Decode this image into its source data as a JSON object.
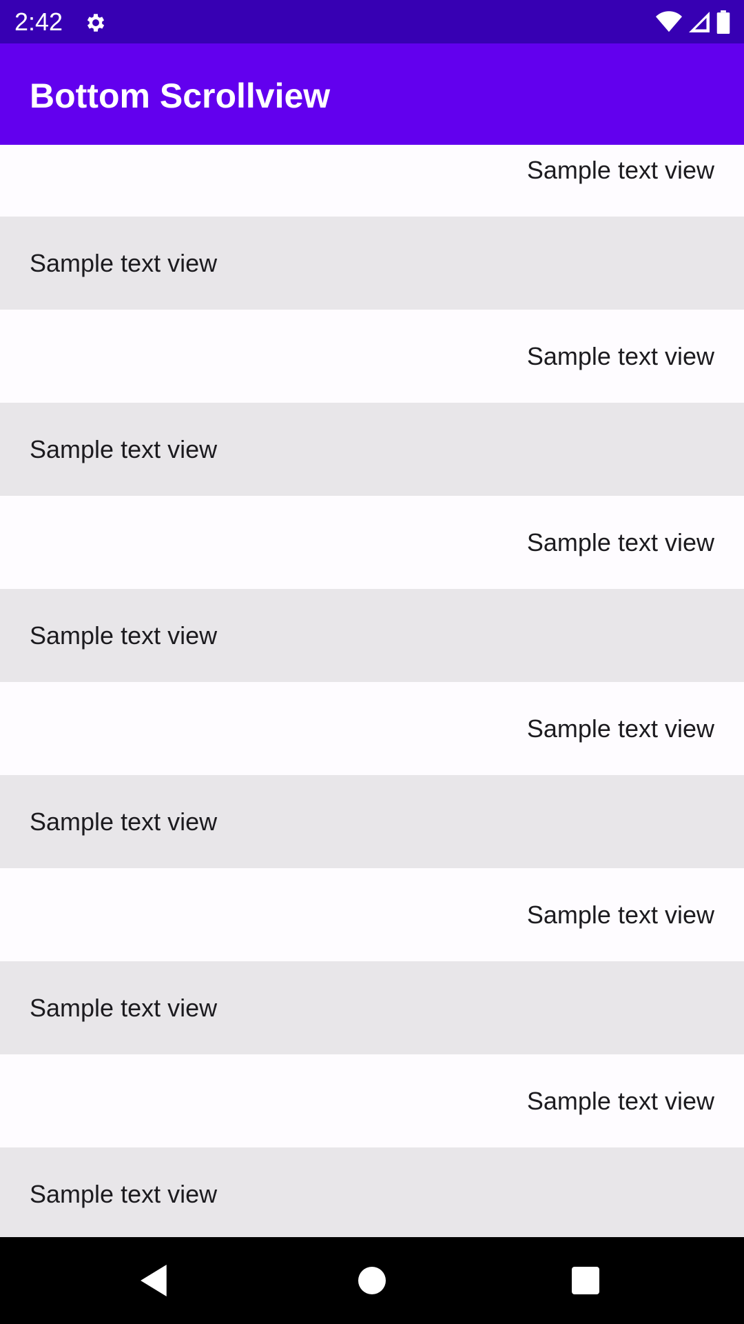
{
  "status_bar": {
    "time": "2:42",
    "icons": [
      "gear-icon",
      "wifi-icon",
      "signal-icon",
      "battery-icon"
    ],
    "background": "#3700b3"
  },
  "app_bar": {
    "title": "Bottom Scrollview",
    "background": "#6200ee"
  },
  "list": {
    "items": [
      {
        "label": "Sample text view",
        "align": "right",
        "shade": "light"
      },
      {
        "label": "Sample text view",
        "align": "left",
        "shade": "gray"
      },
      {
        "label": "Sample text view",
        "align": "right",
        "shade": "light"
      },
      {
        "label": "Sample text view",
        "align": "left",
        "shade": "gray"
      },
      {
        "label": "Sample text view",
        "align": "right",
        "shade": "light"
      },
      {
        "label": "Sample text view",
        "align": "left",
        "shade": "gray"
      },
      {
        "label": "Sample text view",
        "align": "right",
        "shade": "light"
      },
      {
        "label": "Sample text view",
        "align": "left",
        "shade": "gray"
      },
      {
        "label": "Sample text view",
        "align": "right",
        "shade": "light"
      },
      {
        "label": "Sample text view",
        "align": "left",
        "shade": "gray"
      },
      {
        "label": "Sample text view",
        "align": "right",
        "shade": "light"
      },
      {
        "label": "Sample text view",
        "align": "left",
        "shade": "gray"
      }
    ]
  },
  "nav_bar": {
    "buttons": [
      "back-icon",
      "home-icon",
      "recents-icon"
    ]
  }
}
